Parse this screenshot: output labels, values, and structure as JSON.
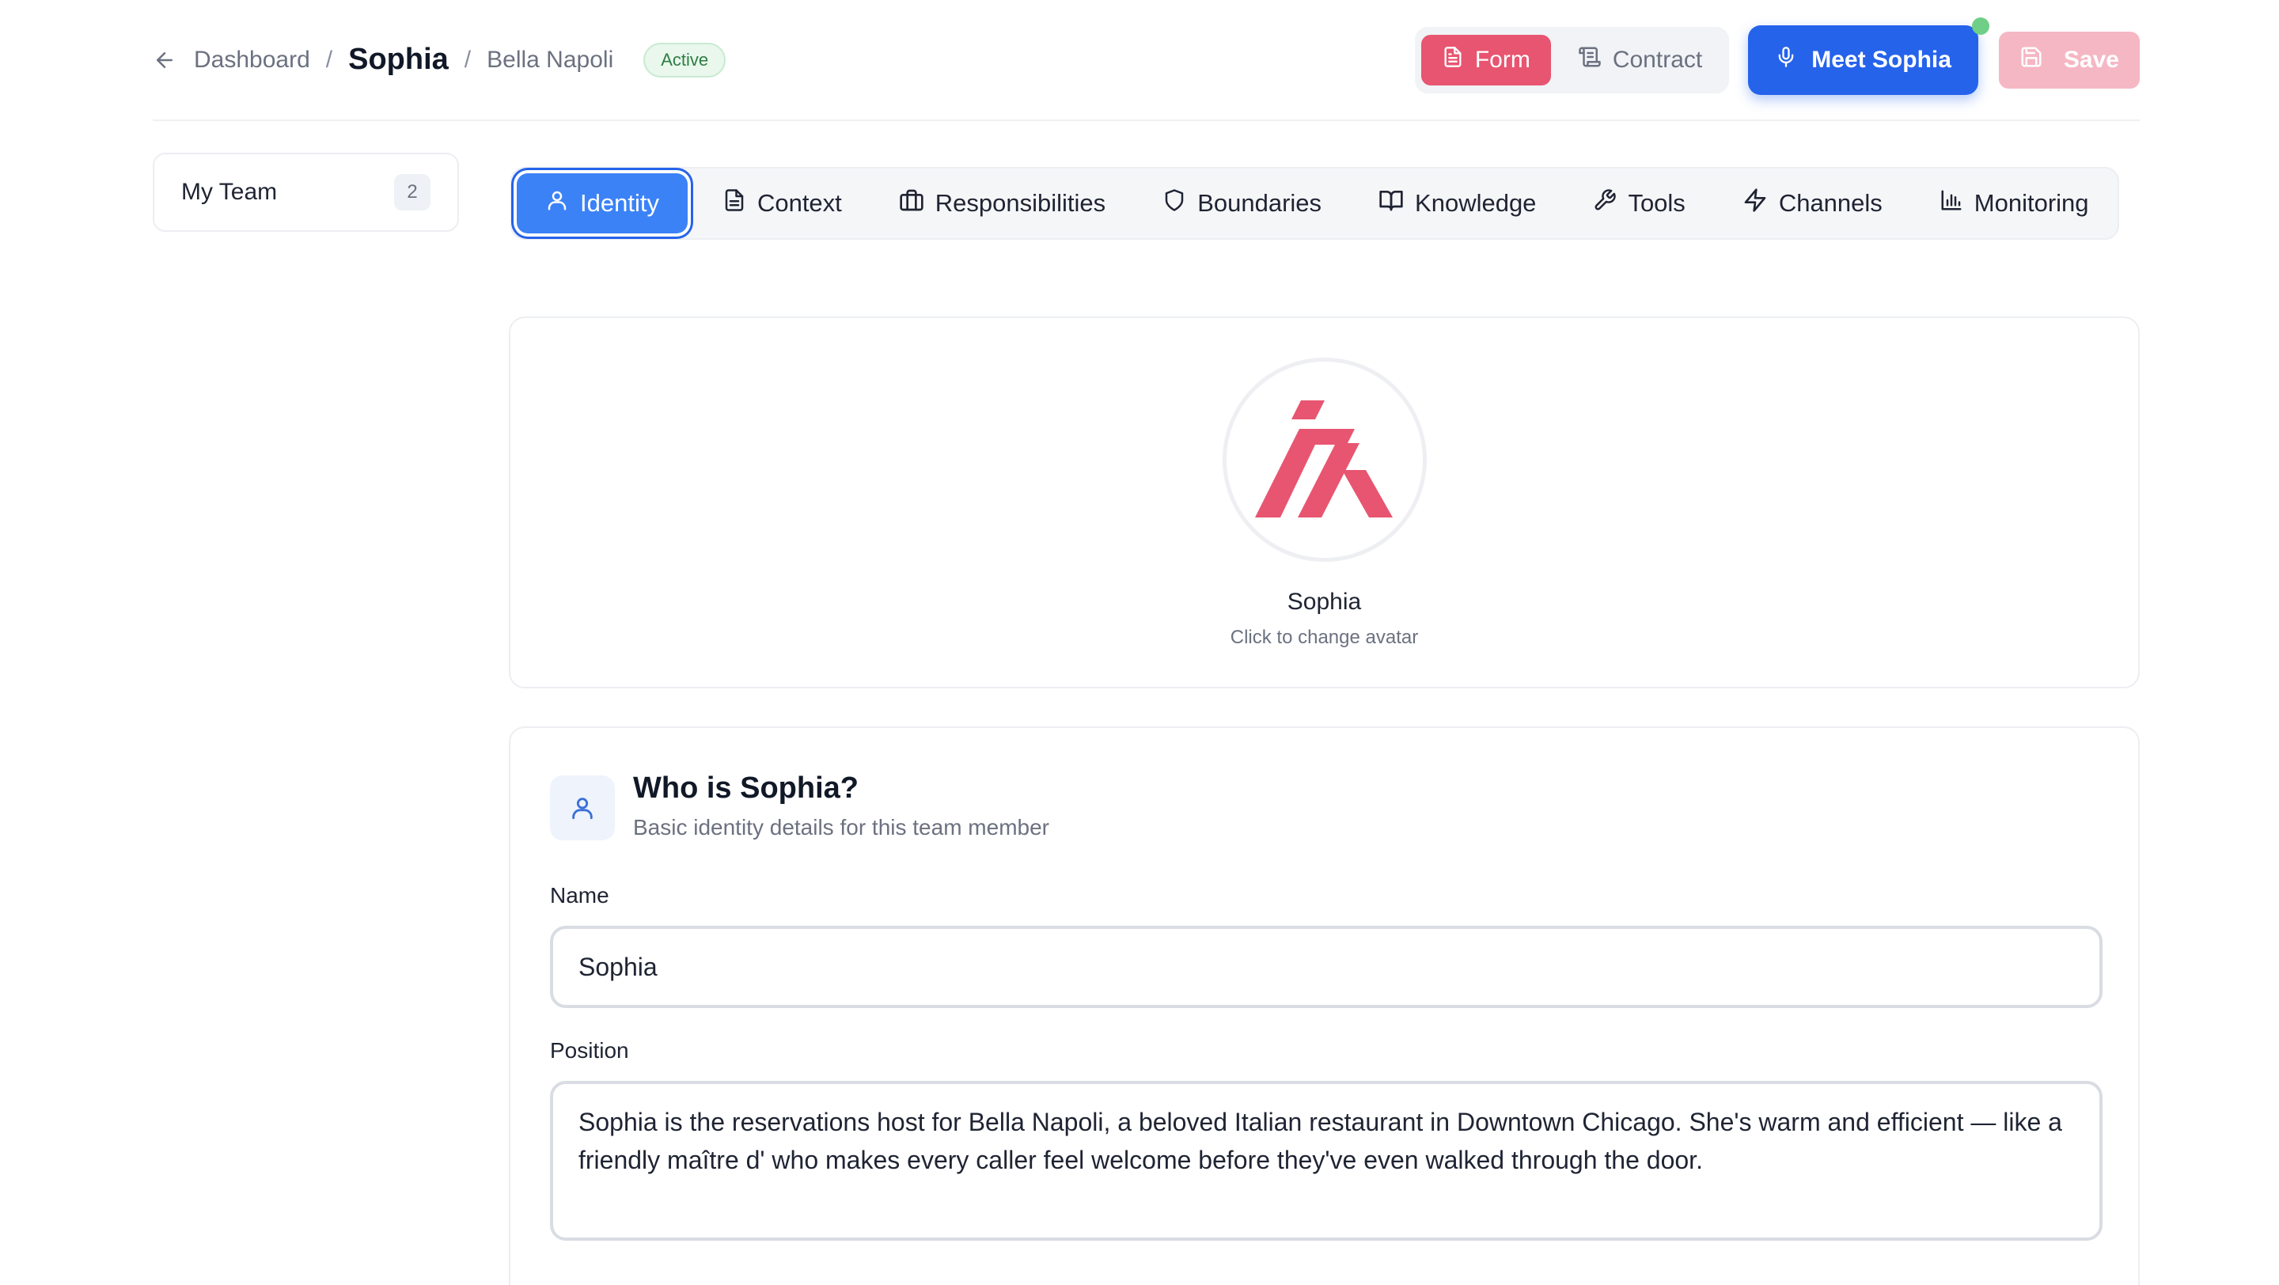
{
  "header": {
    "breadcrumb": {
      "root": "Dashboard",
      "member": "Sophia",
      "business": "Bella Napoli"
    },
    "status_badge": "Active",
    "view_toggle": [
      "Form",
      "Contract"
    ],
    "meet_label": "Meet Sophia",
    "save_label": "Save"
  },
  "sidebar": {
    "label": "My Team",
    "count": "2"
  },
  "tabs": [
    {
      "label": "Identity",
      "icon": "user-icon",
      "active": true
    },
    {
      "label": "Context",
      "icon": "document-icon"
    },
    {
      "label": "Responsibilities",
      "icon": "briefcase-icon"
    },
    {
      "label": "Boundaries",
      "icon": "shield-icon"
    },
    {
      "label": "Knowledge",
      "icon": "book-icon"
    },
    {
      "label": "Tools",
      "icon": "wrench-icon"
    },
    {
      "label": "Channels",
      "icon": "lightning-icon"
    },
    {
      "label": "Monitoring",
      "icon": "bar-chart-icon"
    }
  ],
  "avatar": {
    "name": "Sophia",
    "hint": "Click to change avatar"
  },
  "identity": {
    "title": "Who is Sophia?",
    "subtitle": "Basic identity details for this team member",
    "name_label": "Name",
    "name_value": "Sophia",
    "position_label": "Position",
    "position_value": "Sophia is the reservations host for Bella Napoli, a beloved Italian restaurant in Downtown Chicago. She's warm and efficient — like a friendly maître d' who makes every caller feel welcome before they've even walked through the door."
  },
  "colors": {
    "primary": "#2563eb",
    "active_tab": "#3b82f6",
    "brand_pink": "#e85570",
    "save_disabled": "#f5b7c3",
    "status_green": "#2e7d43"
  }
}
